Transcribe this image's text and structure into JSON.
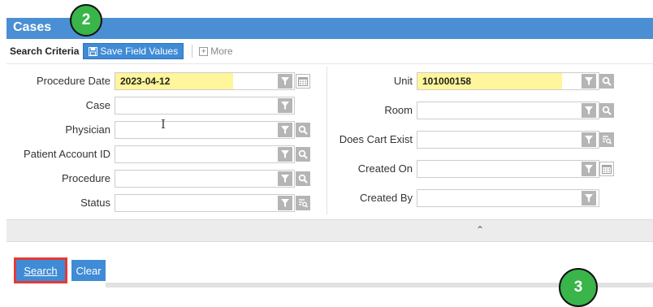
{
  "header": {
    "title": "Cases"
  },
  "steps": {
    "top": "2",
    "bottom": "3"
  },
  "criteria": {
    "label": "Search Criteria",
    "save_label": "Save Field Values",
    "more_label": "More"
  },
  "left_fields": [
    {
      "label": "Procedure Date",
      "value": "2023-04-12",
      "highlighted": true,
      "icons": [
        "filter-icon",
        "calendar-icon"
      ]
    },
    {
      "label": "Case",
      "value": "",
      "highlighted": false,
      "icons": [
        "filter-icon"
      ]
    },
    {
      "label": "Physician",
      "value": "",
      "highlighted": false,
      "icons": [
        "filter-icon",
        "search-icon"
      ]
    },
    {
      "label": "Patient Account ID",
      "value": "",
      "highlighted": false,
      "icons": [
        "filter-icon",
        "search-icon"
      ]
    },
    {
      "label": "Procedure",
      "value": "",
      "highlighted": false,
      "icons": [
        "filter-icon",
        "search-icon"
      ]
    },
    {
      "label": "Status",
      "value": "",
      "highlighted": false,
      "icons": [
        "filter-icon",
        "list-search-icon"
      ]
    }
  ],
  "right_fields": [
    {
      "label": "Unit",
      "value": "101000158",
      "highlighted": true,
      "icons": [
        "filter-icon",
        "search-icon"
      ]
    },
    {
      "label": "Room",
      "value": "",
      "highlighted": false,
      "icons": [
        "filter-icon",
        "search-icon"
      ]
    },
    {
      "label": "Does Cart Exist",
      "value": "",
      "highlighted": false,
      "icons": [
        "filter-icon",
        "list-search-icon"
      ]
    },
    {
      "label": "Created On",
      "value": "",
      "highlighted": false,
      "icons": [
        "filter-icon",
        "calendar-icon"
      ]
    },
    {
      "label": "Created By",
      "value": "",
      "highlighted": false,
      "icons": [
        "filter-icon"
      ]
    }
  ],
  "actions": {
    "search_label": "Search",
    "clear_label": "Clear"
  },
  "colors": {
    "header": "#4a8fd4",
    "button": "#3f8bd6",
    "highlight": "#fff59a",
    "step": "#39b54a",
    "focus_outline": "#e53935"
  }
}
